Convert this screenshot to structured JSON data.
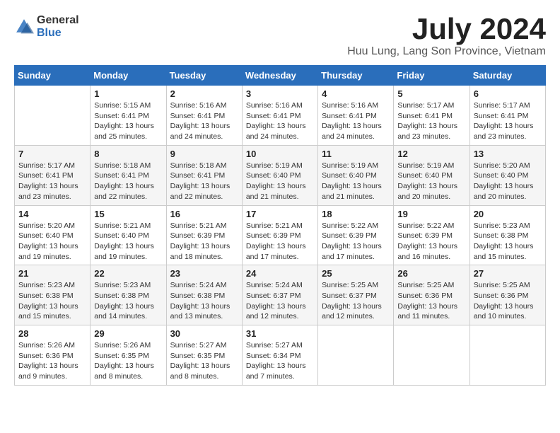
{
  "logo": {
    "general": "General",
    "blue": "Blue"
  },
  "title": "July 2024",
  "location": "Huu Lung, Lang Son Province, Vietnam",
  "days_of_week": [
    "Sunday",
    "Monday",
    "Tuesday",
    "Wednesday",
    "Thursday",
    "Friday",
    "Saturday"
  ],
  "weeks": [
    [
      {
        "day": "",
        "info": ""
      },
      {
        "day": "1",
        "info": "Sunrise: 5:15 AM\nSunset: 6:41 PM\nDaylight: 13 hours\nand 25 minutes."
      },
      {
        "day": "2",
        "info": "Sunrise: 5:16 AM\nSunset: 6:41 PM\nDaylight: 13 hours\nand 24 minutes."
      },
      {
        "day": "3",
        "info": "Sunrise: 5:16 AM\nSunset: 6:41 PM\nDaylight: 13 hours\nand 24 minutes."
      },
      {
        "day": "4",
        "info": "Sunrise: 5:16 AM\nSunset: 6:41 PM\nDaylight: 13 hours\nand 24 minutes."
      },
      {
        "day": "5",
        "info": "Sunrise: 5:17 AM\nSunset: 6:41 PM\nDaylight: 13 hours\nand 23 minutes."
      },
      {
        "day": "6",
        "info": "Sunrise: 5:17 AM\nSunset: 6:41 PM\nDaylight: 13 hours\nand 23 minutes."
      }
    ],
    [
      {
        "day": "7",
        "info": "Sunrise: 5:17 AM\nSunset: 6:41 PM\nDaylight: 13 hours\nand 23 minutes."
      },
      {
        "day": "8",
        "info": "Sunrise: 5:18 AM\nSunset: 6:41 PM\nDaylight: 13 hours\nand 22 minutes."
      },
      {
        "day": "9",
        "info": "Sunrise: 5:18 AM\nSunset: 6:41 PM\nDaylight: 13 hours\nand 22 minutes."
      },
      {
        "day": "10",
        "info": "Sunrise: 5:19 AM\nSunset: 6:40 PM\nDaylight: 13 hours\nand 21 minutes."
      },
      {
        "day": "11",
        "info": "Sunrise: 5:19 AM\nSunset: 6:40 PM\nDaylight: 13 hours\nand 21 minutes."
      },
      {
        "day": "12",
        "info": "Sunrise: 5:19 AM\nSunset: 6:40 PM\nDaylight: 13 hours\nand 20 minutes."
      },
      {
        "day": "13",
        "info": "Sunrise: 5:20 AM\nSunset: 6:40 PM\nDaylight: 13 hours\nand 20 minutes."
      }
    ],
    [
      {
        "day": "14",
        "info": "Sunrise: 5:20 AM\nSunset: 6:40 PM\nDaylight: 13 hours\nand 19 minutes."
      },
      {
        "day": "15",
        "info": "Sunrise: 5:21 AM\nSunset: 6:40 PM\nDaylight: 13 hours\nand 19 minutes."
      },
      {
        "day": "16",
        "info": "Sunrise: 5:21 AM\nSunset: 6:39 PM\nDaylight: 13 hours\nand 18 minutes."
      },
      {
        "day": "17",
        "info": "Sunrise: 5:21 AM\nSunset: 6:39 PM\nDaylight: 13 hours\nand 17 minutes."
      },
      {
        "day": "18",
        "info": "Sunrise: 5:22 AM\nSunset: 6:39 PM\nDaylight: 13 hours\nand 17 minutes."
      },
      {
        "day": "19",
        "info": "Sunrise: 5:22 AM\nSunset: 6:39 PM\nDaylight: 13 hours\nand 16 minutes."
      },
      {
        "day": "20",
        "info": "Sunrise: 5:23 AM\nSunset: 6:38 PM\nDaylight: 13 hours\nand 15 minutes."
      }
    ],
    [
      {
        "day": "21",
        "info": "Sunrise: 5:23 AM\nSunset: 6:38 PM\nDaylight: 13 hours\nand 15 minutes."
      },
      {
        "day": "22",
        "info": "Sunrise: 5:23 AM\nSunset: 6:38 PM\nDaylight: 13 hours\nand 14 minutes."
      },
      {
        "day": "23",
        "info": "Sunrise: 5:24 AM\nSunset: 6:38 PM\nDaylight: 13 hours\nand 13 minutes."
      },
      {
        "day": "24",
        "info": "Sunrise: 5:24 AM\nSunset: 6:37 PM\nDaylight: 13 hours\nand 12 minutes."
      },
      {
        "day": "25",
        "info": "Sunrise: 5:25 AM\nSunset: 6:37 PM\nDaylight: 13 hours\nand 12 minutes."
      },
      {
        "day": "26",
        "info": "Sunrise: 5:25 AM\nSunset: 6:36 PM\nDaylight: 13 hours\nand 11 minutes."
      },
      {
        "day": "27",
        "info": "Sunrise: 5:25 AM\nSunset: 6:36 PM\nDaylight: 13 hours\nand 10 minutes."
      }
    ],
    [
      {
        "day": "28",
        "info": "Sunrise: 5:26 AM\nSunset: 6:36 PM\nDaylight: 13 hours\nand 9 minutes."
      },
      {
        "day": "29",
        "info": "Sunrise: 5:26 AM\nSunset: 6:35 PM\nDaylight: 13 hours\nand 8 minutes."
      },
      {
        "day": "30",
        "info": "Sunrise: 5:27 AM\nSunset: 6:35 PM\nDaylight: 13 hours\nand 8 minutes."
      },
      {
        "day": "31",
        "info": "Sunrise: 5:27 AM\nSunset: 6:34 PM\nDaylight: 13 hours\nand 7 minutes."
      },
      {
        "day": "",
        "info": ""
      },
      {
        "day": "",
        "info": ""
      },
      {
        "day": "",
        "info": ""
      }
    ]
  ]
}
